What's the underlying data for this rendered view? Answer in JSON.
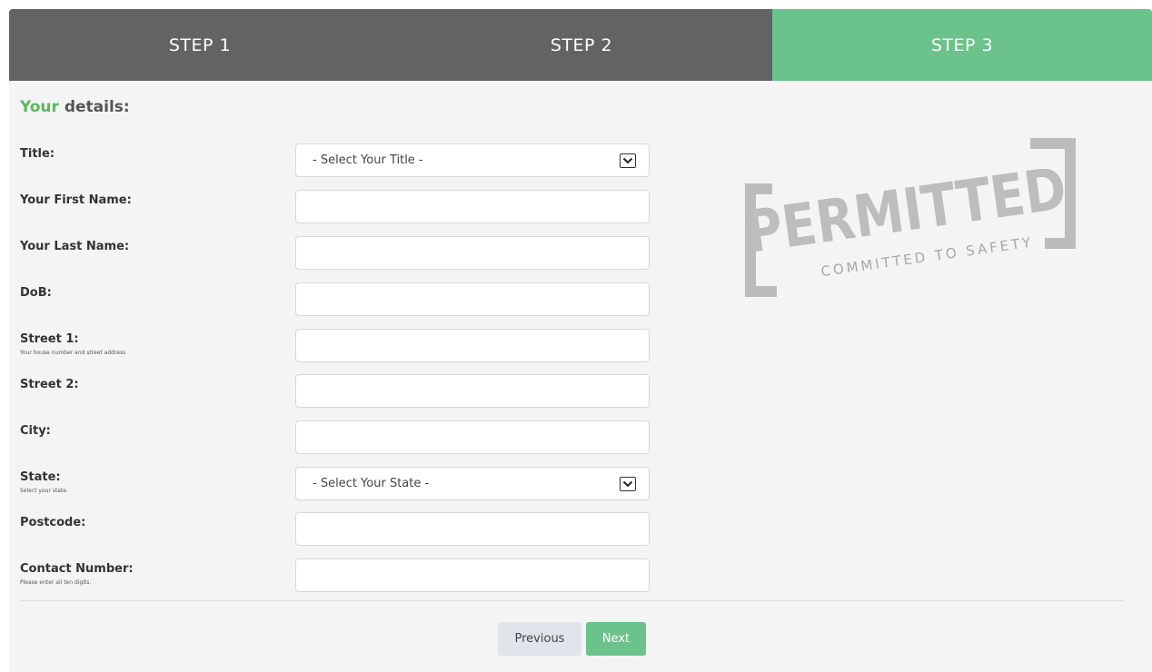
{
  "steps": [
    {
      "label": "STEP 1"
    },
    {
      "label": "STEP 2"
    },
    {
      "label": "STEP 3"
    }
  ],
  "colors": {
    "step_inactive": "#636363",
    "step_active": "#6bc28a",
    "accent": "#5cb85c",
    "background": "#f4f4f4"
  },
  "heading": {
    "accent": "Your",
    "rest": " details:"
  },
  "form": {
    "title": {
      "label": "Title:",
      "selected": "- Select Your Title -"
    },
    "first_name": {
      "label": "Your First Name:",
      "value": ""
    },
    "last_name": {
      "label": "Your Last Name:",
      "value": ""
    },
    "dob": {
      "label": "DoB:",
      "value": ""
    },
    "street1": {
      "label": "Street 1:",
      "hint": "Your house number and street address",
      "value": ""
    },
    "street2": {
      "label": "Street 2:",
      "value": ""
    },
    "city": {
      "label": "City:",
      "value": ""
    },
    "state": {
      "label": "State:",
      "hint": "Select your state.",
      "selected": "- Select Your State -"
    },
    "postcode": {
      "label": "Postcode:",
      "value": ""
    },
    "contact": {
      "label": "Contact Number:",
      "hint": "Please enter all ten digits.",
      "value": ""
    }
  },
  "watermark": {
    "brand": "PERMITTED",
    "tagline": "COMMITTED TO SAFETY"
  },
  "buttons": {
    "previous": "Previous",
    "next": "Next"
  }
}
